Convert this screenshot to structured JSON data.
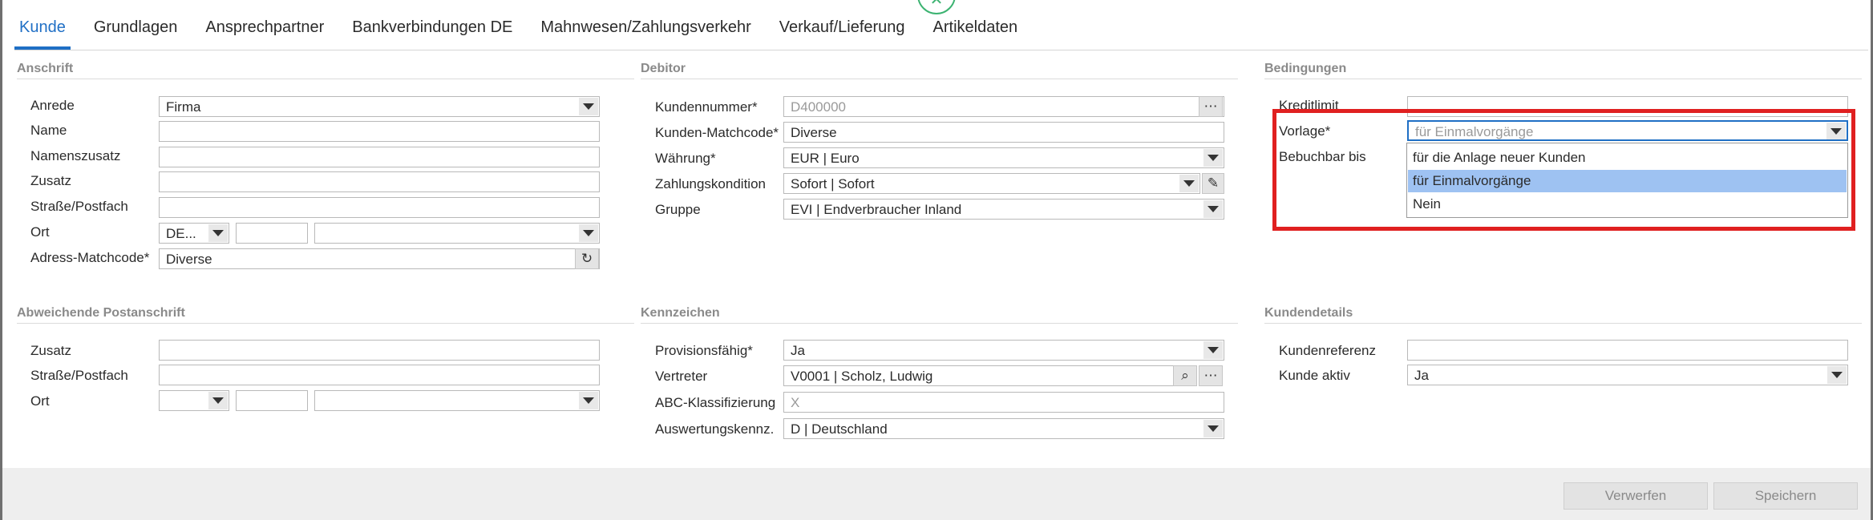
{
  "tabs": [
    "Kunde",
    "Grundlagen",
    "Ansprechpartner",
    "Bankverbindungen DE",
    "Mahnwesen/Zahlungsverkehr",
    "Verkauf/Lieferung",
    "Artikeldaten"
  ],
  "anschrift": {
    "title": "Anschrift",
    "anrede_label": "Anrede",
    "anrede_value": "Firma",
    "name_label": "Name",
    "name_value": "",
    "namenszusatz_label": "Namenszusatz",
    "zusatz_label": "Zusatz",
    "strasse_label": "Straße/Postfach",
    "ort_label": "Ort",
    "ort_country": "DE...",
    "adress_matchcode_label": "Adress-Matchcode*",
    "adress_matchcode_value": "Diverse"
  },
  "debitor": {
    "title": "Debitor",
    "kundennummer_label": "Kundennummer*",
    "kundennummer_value": "D400000",
    "matchcode_label": "Kunden-Matchcode*",
    "matchcode_value": "Diverse",
    "waehrung_label": "Währung*",
    "waehrung_value": "EUR  |  Euro",
    "zahlungskondition_label": "Zahlungskondition",
    "zahlungskondition_value": "Sofort  |  Sofort",
    "gruppe_label": "Gruppe",
    "gruppe_value": "EVI  |  Endverbraucher Inland"
  },
  "bedingungen": {
    "title": "Bedingungen",
    "kreditlimit_label": "Kreditlimit",
    "vorlage_label": "Vorlage*",
    "vorlage_value": "für Einmalvorgänge",
    "bebuchbar_label": "Bebuchbar bis",
    "options": [
      "für die Anlage neuer Kunden",
      "für Einmalvorgänge",
      "Nein"
    ]
  },
  "abweichend": {
    "title": "Abweichende Postanschrift",
    "zusatz_label": "Zusatz",
    "strasse_label": "Straße/Postfach",
    "ort_label": "Ort"
  },
  "kennzeichen": {
    "title": "Kennzeichen",
    "provision_label": "Provisionsfähig*",
    "provision_value": "Ja",
    "vertreter_label": "Vertreter",
    "vertreter_value": "V0001  |  Scholz, Ludwig",
    "abc_label": "ABC-Klassifizierung",
    "abc_value": "X",
    "auswertung_label": "Auswertungskennz.",
    "auswertung_value": "D  |  Deutschland"
  },
  "kundendetails": {
    "title": "Kundendetails",
    "referenz_label": "Kundenreferenz",
    "aktiv_label": "Kunde aktiv",
    "aktiv_value": "Ja"
  },
  "buttons": {
    "discard": "Verwerfen",
    "save": "Speichern"
  },
  "icons": {
    "more": "⋯",
    "refresh": "↻",
    "search": "⌕",
    "edit": "✎"
  },
  "colors": {
    "accent": "#1f6fc5",
    "highlight": "#e02020",
    "selected_option": "#9ec2f2"
  }
}
